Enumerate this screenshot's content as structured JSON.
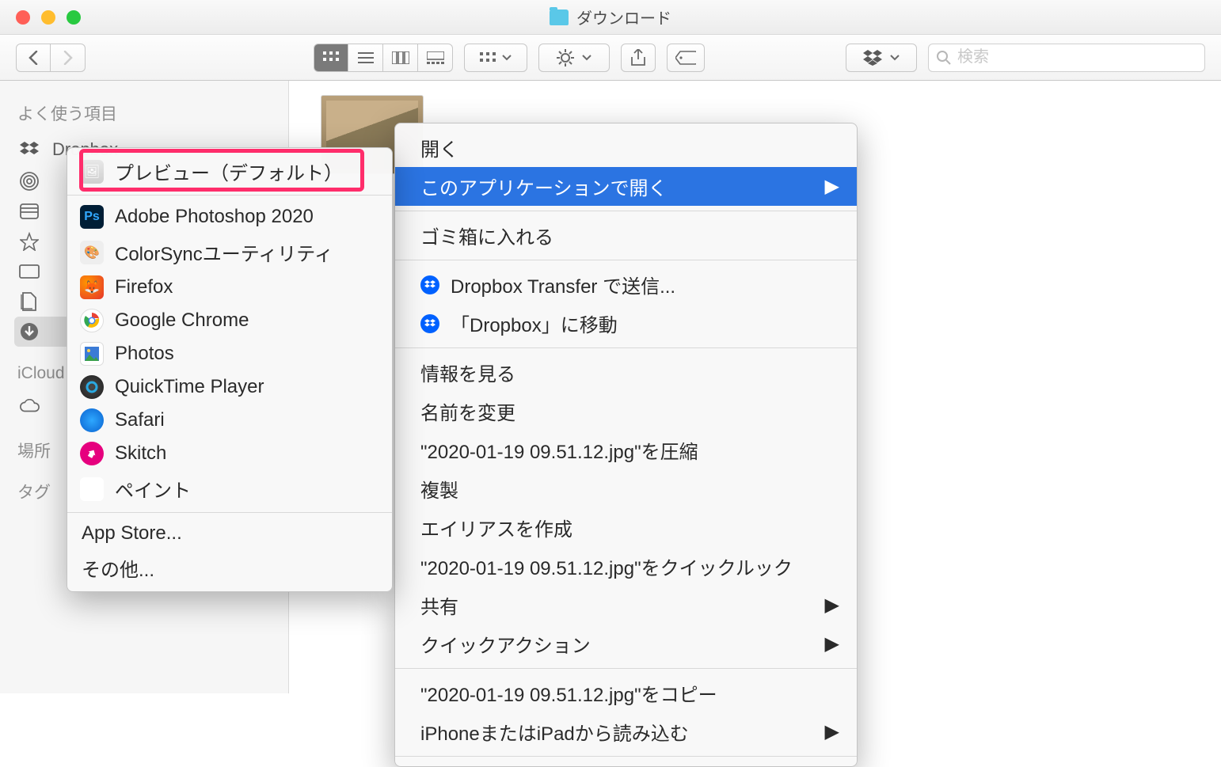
{
  "window_title": "ダウンロード",
  "search_placeholder": "検索",
  "sidebar": {
    "favorites_header": "よく使う項目",
    "dropbox": "Dropbox",
    "icloud_header": "iCloud",
    "locations_header": "場所",
    "tags_header": "タグ"
  },
  "context_menu": {
    "open": "開く",
    "open_with": "このアプリケーションで開く",
    "trash": "ゴミ箱に入れる",
    "dropbox_transfer": "Dropbox Transfer で送信...",
    "dropbox_move": "「Dropbox」に移動",
    "get_info": "情報を見る",
    "rename": "名前を変更",
    "compress": "\"2020-01-19 09.51.12.jpg\"を圧縮",
    "duplicate": "複製",
    "make_alias": "エイリアスを作成",
    "quicklook": "\"2020-01-19 09.51.12.jpg\"をクイックルック",
    "share": "共有",
    "quick_action": "クイックアクション",
    "copy": "\"2020-01-19 09.51.12.jpg\"をコピー",
    "import": "iPhoneまたはiPadから読み込む"
  },
  "open_with_apps": {
    "preview": "プレビュー（デフォルト）",
    "photoshop": "Adobe Photoshop 2020",
    "colorsync": "ColorSyncユーティリティ",
    "firefox": "Firefox",
    "chrome": "Google Chrome",
    "photos": "Photos",
    "quicktime": "QuickTime Player",
    "safari": "Safari",
    "skitch": "Skitch",
    "paint": "ペイント",
    "appstore": "App Store...",
    "other": "その他..."
  }
}
